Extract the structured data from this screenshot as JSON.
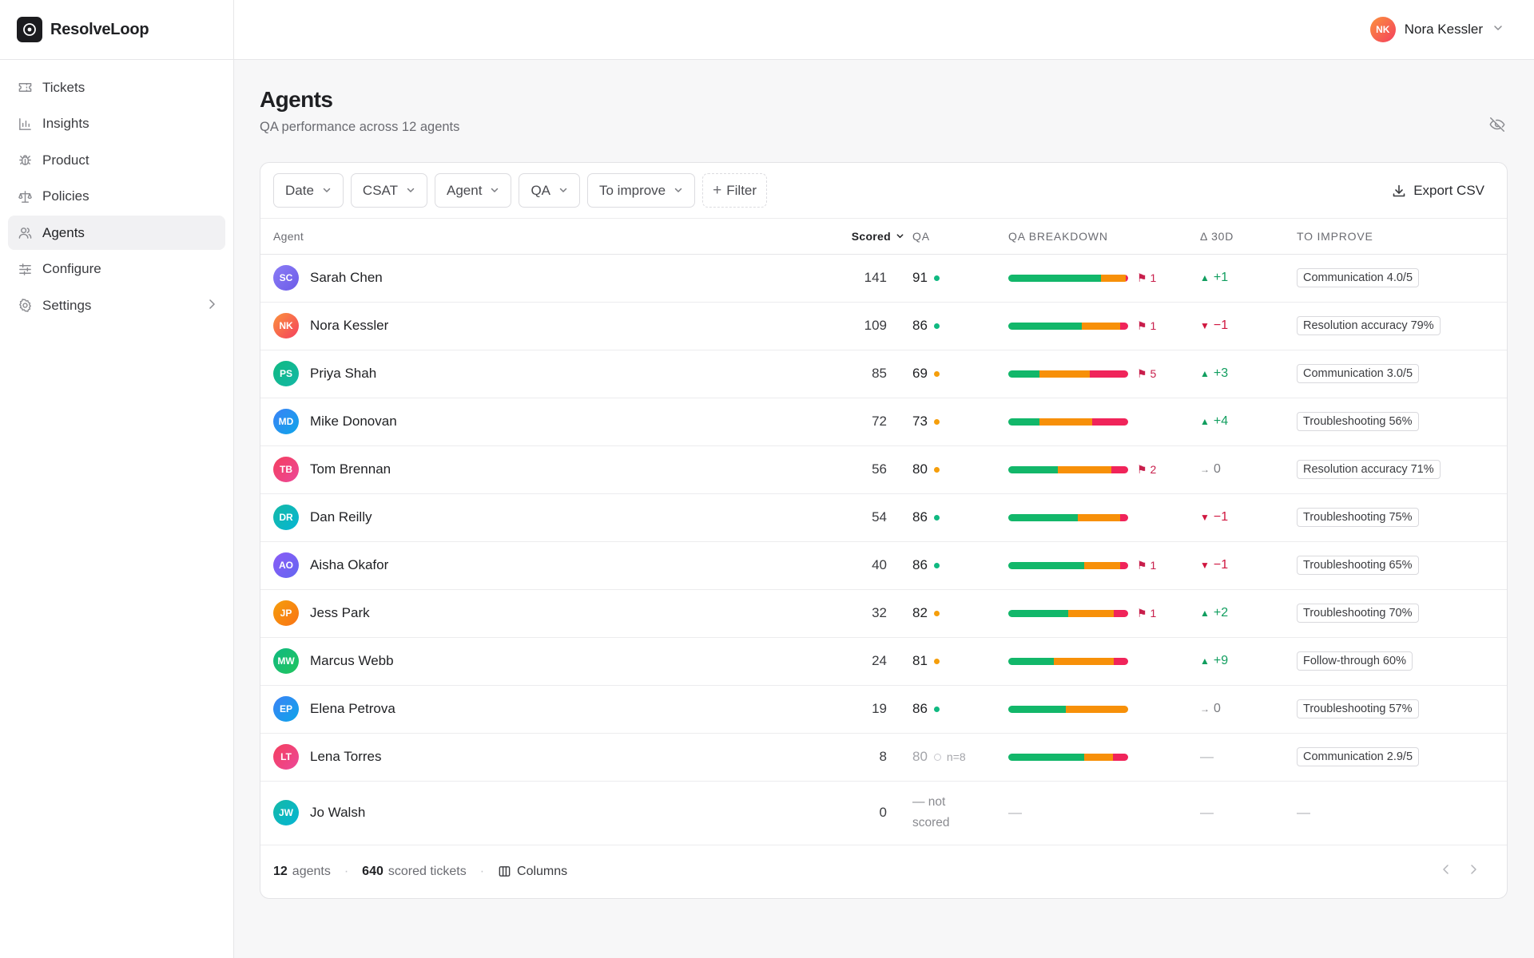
{
  "app": {
    "name": "ResolveLoop"
  },
  "sidebar": {
    "items": [
      {
        "label": "Tickets",
        "icon": "ticket-icon",
        "active": false
      },
      {
        "label": "Insights",
        "icon": "bar-chart-icon",
        "active": false
      },
      {
        "label": "Product",
        "icon": "bug-icon",
        "active": false
      },
      {
        "label": "Policies",
        "icon": "scale-icon",
        "active": false
      },
      {
        "label": "Agents",
        "icon": "users-icon",
        "active": true
      },
      {
        "label": "Configure",
        "icon": "sliders-icon",
        "active": false
      },
      {
        "label": "Settings",
        "icon": "gear-icon",
        "active": false,
        "has_chevron": true
      }
    ]
  },
  "user": {
    "name": "Nora Kessler",
    "initials": "NK"
  },
  "page": {
    "title": "Agents",
    "subtitle": "QA performance across 12 agents"
  },
  "toolbar": {
    "filters": [
      "Date",
      "CSAT",
      "Agent",
      "QA",
      "To improve"
    ],
    "add_filter": "Filter",
    "export": "Export CSV"
  },
  "table": {
    "headers": {
      "agent": "Agent",
      "scored": "Scored",
      "qa": "QA",
      "breakdown": "QA BREAKDOWN",
      "delta": "Δ 30D",
      "improve": "TO IMPROVE"
    },
    "rows": [
      {
        "initials": "SC",
        "name": "Sarah Chen",
        "avatar": [
          "#8b7cf6",
          "#6c5ce7"
        ],
        "scored": "141",
        "qa": "91",
        "qa_status": "good",
        "breakdown": [
          0.77,
          0.21,
          0.02
        ],
        "flags": "1",
        "delta": "+1",
        "delta_dir": "up",
        "improve": "Communication 4.0/5"
      },
      {
        "initials": "NK",
        "name": "Nora Kessler",
        "avatar": [
          "#fb923c",
          "#f43f5e"
        ],
        "scored": "109",
        "qa": "86",
        "qa_status": "good",
        "breakdown": [
          0.61,
          0.32,
          0.07
        ],
        "flags": "1",
        "delta": "−1",
        "delta_dir": "down",
        "improve": "Resolution accuracy 79%"
      },
      {
        "initials": "PS",
        "name": "Priya Shah",
        "avatar": [
          "#10b981",
          "#14b8a6"
        ],
        "scored": "85",
        "qa": "69",
        "qa_status": "warn",
        "breakdown": [
          0.26,
          0.42,
          0.32
        ],
        "flags": "5",
        "delta": "+3",
        "delta_dir": "up",
        "improve": "Communication 3.0/5"
      },
      {
        "initials": "MD",
        "name": "Mike Donovan",
        "avatar": [
          "#3b82f6",
          "#0ea5e9"
        ],
        "scored": "72",
        "qa": "73",
        "qa_status": "warn",
        "breakdown": [
          0.26,
          0.44,
          0.3
        ],
        "flags": "",
        "delta": "+4",
        "delta_dir": "up",
        "improve": "Troubleshooting 56%"
      },
      {
        "initials": "TB",
        "name": "Tom Brennan",
        "avatar": [
          "#f43f5e",
          "#ec4899"
        ],
        "scored": "56",
        "qa": "80",
        "qa_status": "warn",
        "breakdown": [
          0.41,
          0.45,
          0.14
        ],
        "flags": "2",
        "delta": "0",
        "delta_dir": "flat",
        "improve": "Resolution accuracy 71%"
      },
      {
        "initials": "DR",
        "name": "Dan Reilly",
        "avatar": [
          "#14b8a6",
          "#06b6d4"
        ],
        "scored": "54",
        "qa": "86",
        "qa_status": "good",
        "breakdown": [
          0.58,
          0.35,
          0.07
        ],
        "flags": "",
        "delta": "−1",
        "delta_dir": "down",
        "improve": "Troubleshooting 75%"
      },
      {
        "initials": "AO",
        "name": "Aisha Okafor",
        "avatar": [
          "#8b5cf6",
          "#6366f1"
        ],
        "scored": "40",
        "qa": "86",
        "qa_status": "good",
        "breakdown": [
          0.63,
          0.3,
          0.07
        ],
        "flags": "1",
        "delta": "−1",
        "delta_dir": "down",
        "improve": "Troubleshooting 65%"
      },
      {
        "initials": "JP",
        "name": "Jess Park",
        "avatar": [
          "#f59e0b",
          "#f97316"
        ],
        "scored": "32",
        "qa": "82",
        "qa_status": "warn",
        "breakdown": [
          0.5,
          0.38,
          0.12
        ],
        "flags": "1",
        "delta": "+2",
        "delta_dir": "up",
        "improve": "Troubleshooting 70%"
      },
      {
        "initials": "MW",
        "name": "Marcus Webb",
        "avatar": [
          "#10b981",
          "#22c55e"
        ],
        "scored": "24",
        "qa": "81",
        "qa_status": "warn",
        "breakdown": [
          0.38,
          0.5,
          0.12
        ],
        "flags": "",
        "delta": "+9",
        "delta_dir": "up",
        "improve": "Follow-through 60%"
      },
      {
        "initials": "EP",
        "name": "Elena Petrova",
        "avatar": [
          "#3b82f6",
          "#0ea5e9"
        ],
        "scored": "19",
        "qa": "86",
        "qa_status": "good",
        "breakdown": [
          0.48,
          0.52,
          0.0
        ],
        "flags": "",
        "delta": "0",
        "delta_dir": "flat",
        "improve": "Troubleshooting 57%"
      },
      {
        "initials": "LT",
        "name": "Lena Torres",
        "avatar": [
          "#f43f5e",
          "#ec4899"
        ],
        "scored": "8",
        "qa": "80",
        "qa_status": "low_sample",
        "qa_n": "n=8",
        "breakdown": [
          0.63,
          0.24,
          0.13
        ],
        "flags": "",
        "delta": "—",
        "delta_dir": "none",
        "improve": "Communication 2.9/5"
      },
      {
        "initials": "JW",
        "name": "Jo Walsh",
        "avatar": [
          "#14b8a6",
          "#06b6d4"
        ],
        "scored": "0",
        "qa": "",
        "qa_status": "not_scored",
        "qa_not_line1": "— not",
        "qa_not_line2": "scored",
        "breakdown": null,
        "breakdown_empty": "—",
        "flags": "",
        "delta": "—",
        "delta_dir": "none",
        "improve": "—",
        "improve_empty": true
      }
    ]
  },
  "footer": {
    "agents_count": "12",
    "agents_label": "agents",
    "tickets_count": "640",
    "tickets_label": "scored tickets",
    "columns": "Columns"
  },
  "colors": {
    "good": "#10b981",
    "warn": "#f59e0b",
    "bad": "#f43f5e",
    "seg_good": "#12b76a",
    "seg_warn": "#f79009",
    "seg_bad": "#f0245a"
  }
}
